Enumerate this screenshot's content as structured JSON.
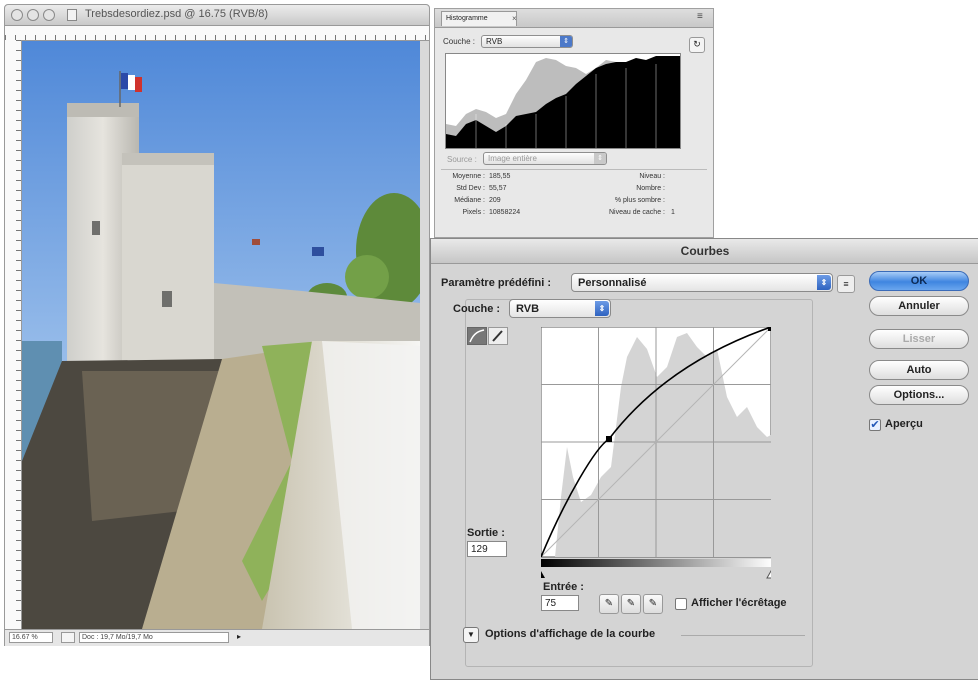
{
  "document": {
    "title": "Trebsdesordiez.psd @ 16.75 (RVB/8)",
    "status": {
      "zoom": "16.67 %",
      "doc_size": "Doc : 19,7 Mo/19,7 Mo"
    }
  },
  "histogram": {
    "tab_label": "Histogramme",
    "close_glyph": "×",
    "channel_label": "Couche :",
    "channel_value": "RVB",
    "source_label": "Source :",
    "source_value": "Image entière",
    "stats_left": [
      {
        "label": "Moyenne :",
        "value": "185,55"
      },
      {
        "label": "Std Dev :",
        "value": "55,57"
      },
      {
        "label": "Médiane :",
        "value": "209"
      },
      {
        "label": "Pixels :",
        "value": "10858224"
      }
    ],
    "stats_right": [
      {
        "label": "Niveau :",
        "value": ""
      },
      {
        "label": "Nombre :",
        "value": ""
      },
      {
        "label": "% plus sombre :",
        "value": ""
      },
      {
        "label": "Niveau de cache :",
        "value": "1"
      }
    ]
  },
  "curves": {
    "title": "Courbes",
    "preset_label": "Paramètre prédéfini :",
    "preset_value": "Personnalisé",
    "channel_label": "Couche :",
    "channel_value": "RVB",
    "output_label": "Sortie :",
    "output_value": "129",
    "input_label": "Entrée :",
    "input_value": "75",
    "clipping_label": "Afficher l'écrêtage",
    "curve_options_label": "Options d'affichage de la courbe",
    "preview_label": "Aperçu",
    "preview_checked": true,
    "buttons": {
      "ok": "OK",
      "cancel": "Annuler",
      "smooth": "Lisser",
      "auto": "Auto",
      "options": "Options..."
    }
  },
  "colors": {
    "accent": "#3f85e0",
    "panel": "#d4d4d4",
    "histogram_fill": "#000000"
  }
}
